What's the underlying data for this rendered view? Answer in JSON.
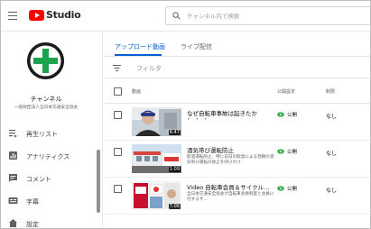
{
  "header": {
    "logo_text": "Studio",
    "search_placeholder": "チャンネル内で検索",
    "brand_color": "#ff0000"
  },
  "sidebar": {
    "channel_label": "チャンネル",
    "channel_sub": "一般財団法人全日本交通安全協会",
    "items": [
      {
        "label": "再生リスト",
        "icon": "playlist-icon"
      },
      {
        "label": "アナリティクス",
        "icon": "analytics-icon"
      },
      {
        "label": "コメント",
        "icon": "comment-icon"
      },
      {
        "label": "字幕",
        "icon": "subtitles-icon"
      },
      {
        "label": "設定",
        "icon": "settings-icon"
      }
    ]
  },
  "main": {
    "tabs": [
      {
        "label": "アップロード動画",
        "active": true
      },
      {
        "label": "ライブ配信",
        "active": false
      }
    ],
    "filter_label": "フィルタ",
    "columns": {
      "video": "動画",
      "visibility": "公開設定",
      "restrictions": "制限"
    },
    "accent_color": "#065fd4",
    "videos": [
      {
        "title": "なぜ自転車事故は起きたか",
        "desc": "",
        "dots": "• • •",
        "duration": "6:47",
        "visibility": "公開",
        "restriction": "なし"
      },
      {
        "title": "酒気帯び運転防止",
        "desc": "飲酒運転防止、特に前日の飲酒による翌朝の酒気帯び運転の防止を呼びかけ",
        "duration": "1:09",
        "visibility": "公開",
        "restriction": "なし"
      },
      {
        "title": "Video 自転車会員＆サイクル…",
        "desc": "全日本交通安全協会が自転車会員制度と会員に付するサ…",
        "duration": "7:06",
        "visibility": "公開",
        "restriction": "なし"
      }
    ]
  }
}
